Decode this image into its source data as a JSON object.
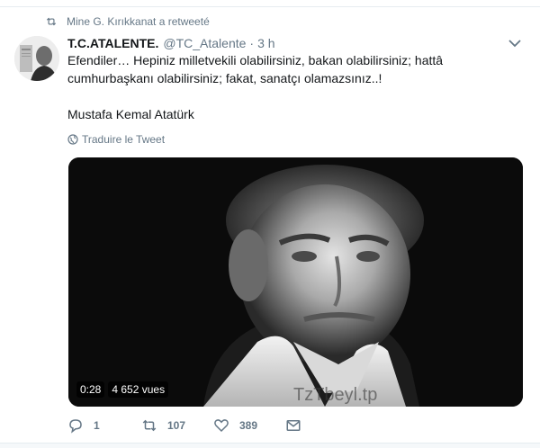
{
  "retweet_context": {
    "text": "Mine G. Kırıkkanat a retweeté",
    "icon": "retweet-icon"
  },
  "tweet": {
    "fullname": "T.C.ATALENTE.",
    "username": "@TC_Atalente",
    "separator": "·",
    "time": "3 h",
    "text_line1": "Efendiler… Hepiniz milletvekili olabilirsiniz, bakan olabilirsiniz; hattâ",
    "text_line2": "cumhurbaşkanı olabilirsiniz; fakat, sanatçı olamazsınız..!",
    "signature": "Mustafa Kemal Atatürk",
    "translate_label": "Traduire le Tweet"
  },
  "media": {
    "duration": "0:28",
    "views": "4 652 vues"
  },
  "actions": {
    "reply_count": "1",
    "retweet_count": "107",
    "like_count": "389"
  },
  "colors": {
    "text": "#14171a",
    "secondary": "#657786",
    "border": "#e6ecf0"
  }
}
